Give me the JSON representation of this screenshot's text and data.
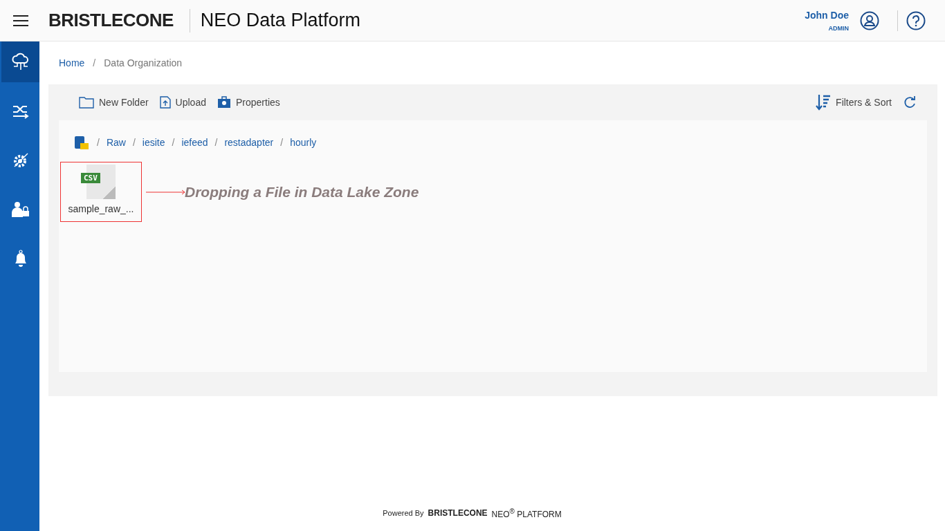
{
  "header": {
    "logo": "BRISTLECONE",
    "title": "NEO Data Platform",
    "user_name": "John Doe",
    "user_role": "ADMIN"
  },
  "sidebar": {
    "items": [
      {
        "selected": true
      },
      {
        "selected": false
      },
      {
        "selected": false
      },
      {
        "selected": false
      },
      {
        "selected": false
      }
    ]
  },
  "breadcrumb": [
    {
      "kind": "link",
      "text": "Home"
    },
    {
      "kind": "separator",
      "text": "/"
    },
    {
      "kind": "current",
      "text": "Data Organization"
    }
  ],
  "toolbar": {
    "left": [
      {
        "label": "New Folder"
      },
      {
        "label": "Upload"
      },
      {
        "label": "Properties"
      }
    ],
    "filters_label": "Filters & Sort"
  },
  "path": [
    {
      "kind": "separator",
      "text": "/"
    },
    {
      "kind": "link",
      "text": "Raw"
    },
    {
      "kind": "separator",
      "text": "/"
    },
    {
      "kind": "link",
      "text": "iesite"
    },
    {
      "kind": "separator",
      "text": "/"
    },
    {
      "kind": "link",
      "text": "iefeed"
    },
    {
      "kind": "separator",
      "text": "/"
    },
    {
      "kind": "link",
      "text": "restadapter"
    },
    {
      "kind": "separator",
      "text": "/"
    },
    {
      "kind": "link",
      "text": "hourly"
    }
  ],
  "files": [
    {
      "type": "CSV",
      "name": "sample_raw_..."
    }
  ],
  "annotation": "Dropping a File in Data Lake Zone",
  "footer": {
    "powered_by": "Powered By",
    "brand": "BRISTLECONE",
    "product": "NEO$^{®}$ PLATFORM"
  }
}
